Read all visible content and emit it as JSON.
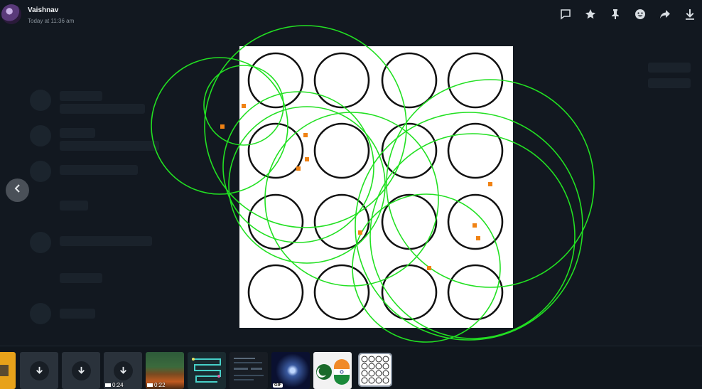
{
  "header": {
    "username": "Vaishnav",
    "timestamp": "Today at 11:36 am"
  },
  "toolbar": {
    "items": [
      {
        "icon": "comment-icon"
      },
      {
        "icon": "star-icon"
      },
      {
        "icon": "pin-icon"
      },
      {
        "icon": "reaction-icon"
      },
      {
        "icon": "forward-icon"
      },
      {
        "icon": "download-icon"
      }
    ]
  },
  "colors": {
    "background": "#121820",
    "overlay_circle": "#22e022",
    "marker": "#f08214",
    "grid_circle": "#111111"
  },
  "filmstrip": {
    "items": [
      {
        "type": "image-partial"
      },
      {
        "type": "download"
      },
      {
        "type": "download"
      },
      {
        "type": "video-download",
        "duration": "0:24"
      },
      {
        "type": "video",
        "duration": "0:22"
      },
      {
        "type": "image-diagram"
      },
      {
        "type": "image-dark-ui"
      },
      {
        "type": "gif",
        "badge": "GIF"
      },
      {
        "type": "image-flags"
      },
      {
        "type": "image-circles",
        "selected": true
      }
    ]
  }
}
